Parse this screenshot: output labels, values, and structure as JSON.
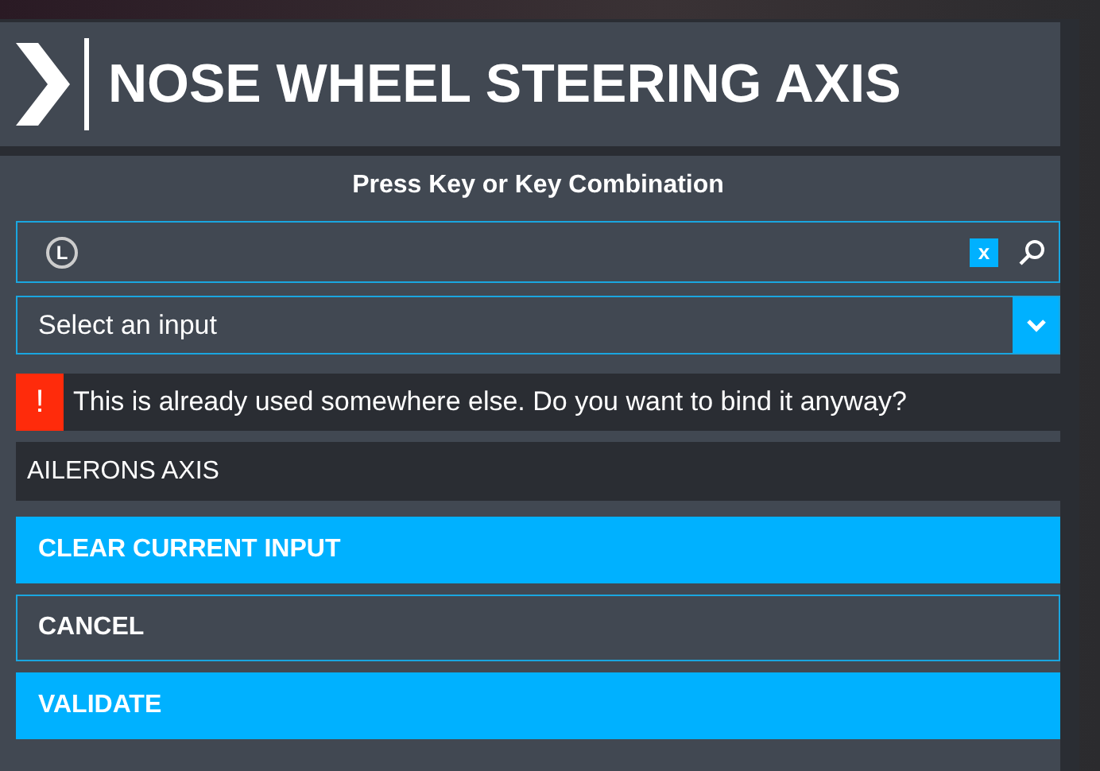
{
  "dialog": {
    "title": "NOSE WHEEL STEERING AXIS"
  },
  "prompt": "Press Key or Key Combination",
  "key_field": {
    "key_label": "L",
    "clear_label": "x"
  },
  "input_select": {
    "placeholder": "Select an input"
  },
  "warning": {
    "mark": "!",
    "message": "This is already used somewhere else. Do you want to bind it anyway?"
  },
  "conflict": "AILERONS AXIS",
  "buttons": [
    {
      "label": "CLEAR CURRENT INPUT",
      "kind": "primary"
    },
    {
      "label": "CANCEL",
      "kind": "outline"
    },
    {
      "label": "VALIDATE",
      "kind": "primary"
    }
  ]
}
